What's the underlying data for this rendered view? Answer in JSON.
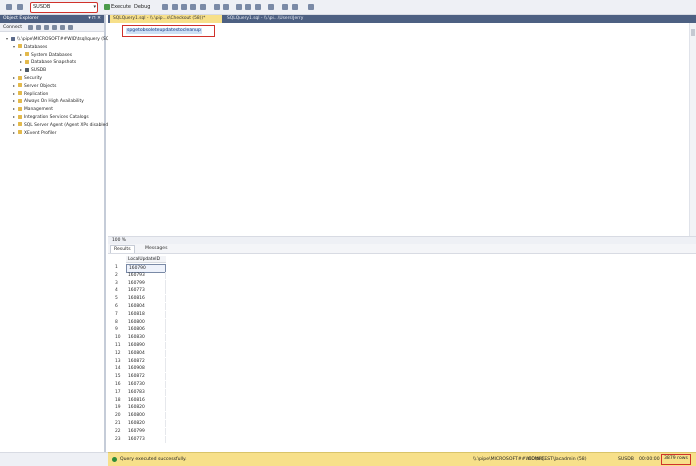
{
  "toolbar": {
    "database": "SUSDB",
    "execute_label": "Execute",
    "debug_label": "Debug"
  },
  "object_explorer": {
    "title": "Object Explorer",
    "connect_label": "Connect",
    "tree": [
      {
        "label": "\\\\.\\pipe\\MICROSOFT##WID\\tsql\\query (SQL Serve",
        "level": 0,
        "icon": "server-icon"
      },
      {
        "label": "Databases",
        "level": 1,
        "icon": "folder-icon"
      },
      {
        "label": "System Databases",
        "level": 2,
        "icon": "folder-icon"
      },
      {
        "label": "Database Snapshots",
        "level": 2,
        "icon": "folder-icon"
      },
      {
        "label": "SUSDB",
        "level": 2,
        "icon": "database-icon"
      },
      {
        "label": "Security",
        "level": 1,
        "icon": "folder-icon"
      },
      {
        "label": "Server Objects",
        "level": 1,
        "icon": "folder-icon"
      },
      {
        "label": "Replication",
        "level": 1,
        "icon": "folder-icon"
      },
      {
        "label": "Always On High Availability",
        "level": 1,
        "icon": "folder-icon"
      },
      {
        "label": "Management",
        "level": 1,
        "icon": "folder-icon"
      },
      {
        "label": "Integration Services Catalogs",
        "level": 1,
        "icon": "folder-icon"
      },
      {
        "label": "SQL Server Agent (Agent XPs disabled)",
        "level": 1,
        "icon": "agent-icon"
      },
      {
        "label": "XEvent Profiler",
        "level": 1,
        "icon": "folder-icon"
      }
    ]
  },
  "tabs": [
    {
      "label": "SQLQuery1.sql - \\\\.\\pip...s\\Checkout (58))*",
      "active": true
    },
    {
      "label": "SQLQuery1.sql - \\\\.\\pi...\\Users\\Jerry",
      "active": false
    }
  ],
  "editor": {
    "sql": "spgetobsoleteupdatestocleanup"
  },
  "zoom": "100 %",
  "results_tabs": [
    {
      "label": "Results",
      "active": true
    },
    {
      "label": "Messages",
      "active": false
    }
  ],
  "grid": {
    "column": "LocalUpdateID",
    "rows": [
      "160790",
      "160793",
      "160799",
      "160773",
      "160816",
      "160804",
      "160818",
      "160800",
      "160806",
      "160830",
      "160890",
      "160804",
      "160872",
      "160908",
      "160872",
      "160730",
      "160783",
      "160816",
      "160820",
      "160800",
      "160820",
      "160799",
      "160773"
    ]
  },
  "status": {
    "message": "Query executed successfully.",
    "server": "\\\\.\\pipe\\MICROSOFT##WID\\tsq...",
    "user": "COMPTEST\\Jacadmin (58)",
    "database": "SUSDB",
    "time": "00:00:00",
    "rows": "3879 rows"
  }
}
